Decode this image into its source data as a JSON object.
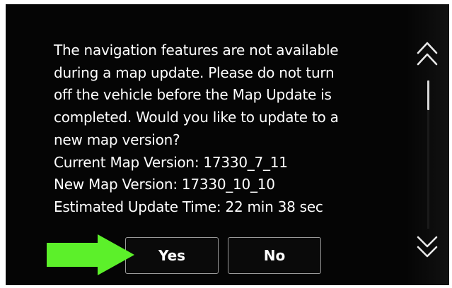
{
  "dialog": {
    "message_lines": [
      "The navigation features are not available",
      "during a map update. Please do not turn",
      "off the vehicle before the Map Update is",
      "completed. Would you like to update to a",
      "new map version?"
    ],
    "current_version_line": "Current Map Version: 17330_7_11",
    "new_version_line": "New Map Version: 17330_10_10",
    "estimated_time_line": "Estimated Update Time: 22 min 38 sec"
  },
  "buttons": {
    "yes_label": "Yes",
    "no_label": "No"
  },
  "icons": {
    "scroll_up": "double-chevron-up-icon",
    "scroll_down": "double-chevron-down-icon",
    "annotation_arrow": "green-arrow-icon"
  },
  "colors": {
    "screen_background": "#050505",
    "text": "#ffffff",
    "button_border": "#9a9a9a",
    "annotation_arrow": "#5cf02a"
  }
}
